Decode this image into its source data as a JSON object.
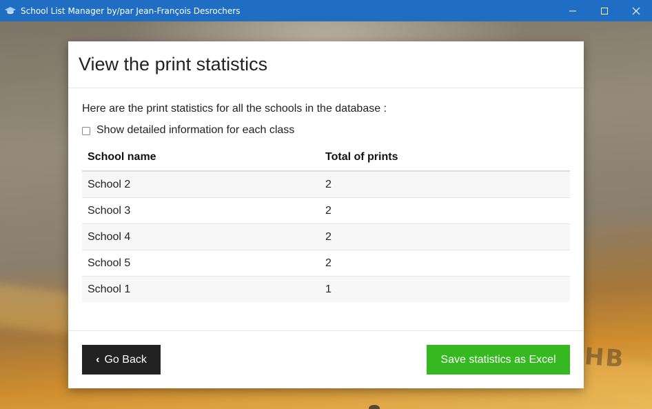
{
  "window": {
    "title": "School List Manager by/par Jean-François Desrochers",
    "accent_color": "#1f6ec4",
    "controls": [
      "minimize-icon",
      "maximize-icon",
      "close-icon"
    ]
  },
  "page": {
    "title": "View the print statistics",
    "intro": "Here are the print statistics for all the schools in the database :",
    "detail_checkbox": {
      "label": "Show detailed information for each class",
      "checked": false
    }
  },
  "table": {
    "headers": [
      "School name",
      "Total of prints"
    ],
    "rows": [
      [
        "School 2",
        "2"
      ],
      [
        "School 3",
        "2"
      ],
      [
        "School 4",
        "2"
      ],
      [
        "School 5",
        "2"
      ],
      [
        "School 1",
        "1"
      ]
    ]
  },
  "footer": {
    "back_button": "Go Back",
    "back_icon": "chevron-left-icon",
    "save_button": "Save statistics as Excel",
    "save_color": "#35b820",
    "back_color": "#222222"
  },
  "background": {
    "pencil_text": "HB"
  }
}
